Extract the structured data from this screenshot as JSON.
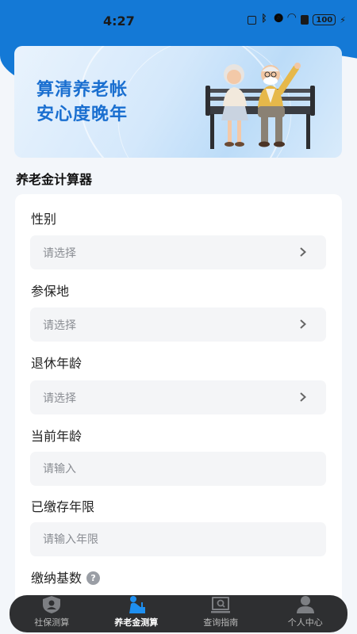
{
  "status_bar": {
    "time": "4:27",
    "battery": "100"
  },
  "banner": {
    "line1": "算清养老帐",
    "line2": "安心度晚年"
  },
  "section_title": "养老金计算器",
  "form": {
    "gender": {
      "label": "性别",
      "placeholder": "请选择"
    },
    "location": {
      "label": "参保地",
      "placeholder": "请选择"
    },
    "retire_age": {
      "label": "退休年龄",
      "placeholder": "请选择"
    },
    "current_age": {
      "label": "当前年龄",
      "placeholder": "请输入"
    },
    "paid_years": {
      "label": "已缴存年限",
      "placeholder": "请输入年限"
    },
    "base": {
      "label": "缴纳基数",
      "help_icon": "question-icon"
    }
  },
  "nav": {
    "items": [
      {
        "label": "社保测算",
        "icon": "shield-user-icon"
      },
      {
        "label": "养老金测算",
        "icon": "elderly-icon"
      },
      {
        "label": "查询指南",
        "icon": "book-search-icon"
      },
      {
        "label": "个人中心",
        "icon": "person-icon"
      }
    ],
    "active_index": 1
  },
  "colors": {
    "accent": "#1479d6",
    "banner_text": "#1a6fd0",
    "nav_bg": "#2e2f31"
  }
}
